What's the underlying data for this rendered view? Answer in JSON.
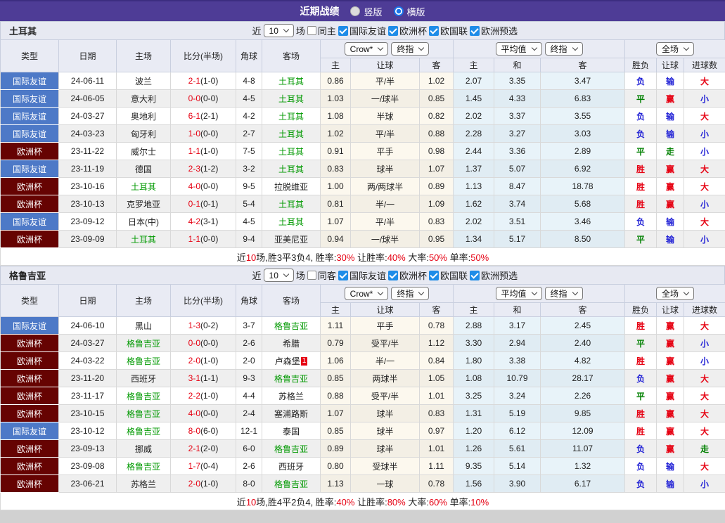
{
  "title_bar": {
    "title": "近期战绩",
    "vertical_label": "竖版",
    "horizontal_label": "横版",
    "selected": "横版"
  },
  "controls": {
    "company": "Crow*",
    "final_index": "终指",
    "average": "平均值",
    "final_index2": "终指",
    "scope": "全场"
  },
  "columns": {
    "left": [
      "类型",
      "日期",
      "主场",
      "比分(半场)",
      "角球",
      "客场"
    ],
    "crow_sub": [
      "主",
      "让球",
      "客"
    ],
    "avg_sub": [
      "主",
      "和",
      "客"
    ],
    "result_sub": [
      "胜负",
      "让球",
      "进球数"
    ]
  },
  "colors": {
    "titlebar_purple": "#4e3c96",
    "badge_friendly_blue": "#4d79c7",
    "badge_cup_maroon": "#660302",
    "win_red": "#e60012",
    "lose_blue": "#2323d6",
    "draw_green": "#008000",
    "team_green": "#009900",
    "crow_col_bg": "#fcf8ee",
    "avg_col_bg": "#e8f3f9",
    "checkbox_blue": "#1e8ce8"
  },
  "sections": [
    {
      "team": "土耳其",
      "filter": {
        "near": "近",
        "count": "10",
        "unit": "场",
        "same": "同主",
        "same_checked": false,
        "leagues": [
          "国际友谊",
          "欧洲杯",
          "欧国联",
          "欧洲预选"
        ],
        "leagues_checked": [
          true,
          true,
          true,
          true
        ]
      },
      "rows": [
        {
          "type": "国际友谊",
          "type_key": "friendly",
          "date": "24-06-11",
          "home": "波兰",
          "home_green": false,
          "score": "2-1",
          "half": "(1-0)",
          "corner": "4-8",
          "away": "土耳其",
          "away_green": true,
          "red_card": "",
          "crow": [
            "0.86",
            "平/半",
            "1.02"
          ],
          "avg": [
            "2.07",
            "3.35",
            "3.47"
          ],
          "res": [
            [
              "负",
              "b"
            ],
            [
              "输",
              "b"
            ],
            [
              "大",
              "r"
            ]
          ]
        },
        {
          "type": "国际友谊",
          "type_key": "friendly",
          "date": "24-06-05",
          "home": "意大利",
          "home_green": false,
          "score": "0-0",
          "half": "(0-0)",
          "corner": "4-5",
          "away": "土耳其",
          "away_green": true,
          "red_card": "",
          "crow": [
            "1.03",
            "一/球半",
            "0.85"
          ],
          "avg": [
            "1.45",
            "4.33",
            "6.83"
          ],
          "res": [
            [
              "平",
              "g"
            ],
            [
              "赢",
              "r"
            ],
            [
              "小",
              "b"
            ]
          ]
        },
        {
          "type": "国际友谊",
          "type_key": "friendly",
          "date": "24-03-27",
          "home": "奥地利",
          "home_green": false,
          "score": "6-1",
          "half": "(2-1)",
          "corner": "4-2",
          "away": "土耳其",
          "away_green": true,
          "red_card": "",
          "crow": [
            "1.08",
            "半球",
            "0.82"
          ],
          "avg": [
            "2.02",
            "3.37",
            "3.55"
          ],
          "res": [
            [
              "负",
              "b"
            ],
            [
              "输",
              "b"
            ],
            [
              "大",
              "r"
            ]
          ]
        },
        {
          "type": "国际友谊",
          "type_key": "friendly",
          "date": "24-03-23",
          "home": "匈牙利",
          "home_green": false,
          "score": "1-0",
          "half": "(0-0)",
          "corner": "2-7",
          "away": "土耳其",
          "away_green": true,
          "red_card": "",
          "crow": [
            "1.02",
            "平/半",
            "0.88"
          ],
          "avg": [
            "2.28",
            "3.27",
            "3.03"
          ],
          "res": [
            [
              "负",
              "b"
            ],
            [
              "输",
              "b"
            ],
            [
              "小",
              "b"
            ]
          ]
        },
        {
          "type": "欧洲杯",
          "type_key": "cup",
          "date": "23-11-22",
          "home": "威尔士",
          "home_green": false,
          "score": "1-1",
          "half": "(1-0)",
          "corner": "7-5",
          "away": "土耳其",
          "away_green": true,
          "red_card": "",
          "crow": [
            "0.91",
            "平手",
            "0.98"
          ],
          "avg": [
            "2.44",
            "3.36",
            "2.89"
          ],
          "res": [
            [
              "平",
              "g"
            ],
            [
              "走",
              "g"
            ],
            [
              "小",
              "b"
            ]
          ]
        },
        {
          "type": "国际友谊",
          "type_key": "friendly",
          "date": "23-11-19",
          "home": "德国",
          "home_green": false,
          "score": "2-3",
          "half": "(1-2)",
          "corner": "3-2",
          "away": "土耳其",
          "away_green": true,
          "red_card": "",
          "crow": [
            "0.83",
            "球半",
            "1.07"
          ],
          "avg": [
            "1.37",
            "5.07",
            "6.92"
          ],
          "res": [
            [
              "胜",
              "r"
            ],
            [
              "赢",
              "r"
            ],
            [
              "大",
              "r"
            ]
          ]
        },
        {
          "type": "欧洲杯",
          "type_key": "cup",
          "date": "23-10-16",
          "home": "土耳其",
          "home_green": true,
          "score": "4-0",
          "half": "(0-0)",
          "corner": "9-5",
          "away": "拉脱维亚",
          "away_green": false,
          "red_card": "",
          "crow": [
            "1.00",
            "两/两球半",
            "0.89"
          ],
          "avg": [
            "1.13",
            "8.47",
            "18.78"
          ],
          "res": [
            [
              "胜",
              "r"
            ],
            [
              "赢",
              "r"
            ],
            [
              "大",
              "r"
            ]
          ]
        },
        {
          "type": "欧洲杯",
          "type_key": "cup",
          "date": "23-10-13",
          "home": "克罗地亚",
          "home_green": false,
          "score": "0-1",
          "half": "(0-1)",
          "corner": "5-4",
          "away": "土耳其",
          "away_green": true,
          "red_card": "",
          "crow": [
            "0.81",
            "半/一",
            "1.09"
          ],
          "avg": [
            "1.62",
            "3.74",
            "5.68"
          ],
          "res": [
            [
              "胜",
              "r"
            ],
            [
              "赢",
              "r"
            ],
            [
              "小",
              "b"
            ]
          ]
        },
        {
          "type": "国际友谊",
          "type_key": "friendly",
          "date": "23-09-12",
          "home": "日本(中)",
          "home_green": false,
          "score": "4-2",
          "half": "(3-1)",
          "corner": "4-5",
          "away": "土耳其",
          "away_green": true,
          "red_card": "",
          "crow": [
            "1.07",
            "平/半",
            "0.83"
          ],
          "avg": [
            "2.02",
            "3.51",
            "3.46"
          ],
          "res": [
            [
              "负",
              "b"
            ],
            [
              "输",
              "b"
            ],
            [
              "大",
              "r"
            ]
          ]
        },
        {
          "type": "欧洲杯",
          "type_key": "cup",
          "date": "23-09-09",
          "home": "土耳其",
          "home_green": true,
          "score": "1-1",
          "half": "(0-0)",
          "corner": "9-4",
          "away": "亚美尼亚",
          "away_green": false,
          "red_card": "",
          "crow": [
            "0.94",
            "一/球半",
            "0.95"
          ],
          "avg": [
            "1.34",
            "5.17",
            "8.50"
          ],
          "res": [
            [
              "平",
              "g"
            ],
            [
              "输",
              "b"
            ],
            [
              "小",
              "b"
            ]
          ]
        }
      ],
      "summary": [
        {
          "t": "近",
          "red": false
        },
        {
          "t": "10",
          "red": true
        },
        {
          "t": "场,胜3平3负4, 胜率:",
          "red": false
        },
        {
          "t": "30%",
          "red": true
        },
        {
          "t": " 让胜率:",
          "red": false
        },
        {
          "t": "40%",
          "red": true
        },
        {
          "t": " 大率:",
          "red": false
        },
        {
          "t": "50%",
          "red": true
        },
        {
          "t": " 单率:",
          "red": false
        },
        {
          "t": "50%",
          "red": true
        }
      ]
    },
    {
      "team": "格鲁吉亚",
      "filter": {
        "near": "近",
        "count": "10",
        "unit": "场",
        "same": "同客",
        "same_checked": false,
        "leagues": [
          "国际友谊",
          "欧洲杯",
          "欧国联",
          "欧洲预选"
        ],
        "leagues_checked": [
          true,
          true,
          true,
          true
        ]
      },
      "rows": [
        {
          "type": "国际友谊",
          "type_key": "friendly",
          "date": "24-06-10",
          "home": "黑山",
          "home_green": false,
          "score": "1-3",
          "half": "(0-2)",
          "corner": "3-7",
          "away": "格鲁吉亚",
          "away_green": true,
          "red_card": "",
          "crow": [
            "1.11",
            "平手",
            "0.78"
          ],
          "avg": [
            "2.88",
            "3.17",
            "2.45"
          ],
          "res": [
            [
              "胜",
              "r"
            ],
            [
              "赢",
              "r"
            ],
            [
              "大",
              "r"
            ]
          ]
        },
        {
          "type": "欧洲杯",
          "type_key": "cup",
          "date": "24-03-27",
          "home": "格鲁吉亚",
          "home_green": true,
          "score": "0-0",
          "half": "(0-0)",
          "corner": "2-6",
          "away": "希腊",
          "away_green": false,
          "red_card": "",
          "crow": [
            "0.79",
            "受平/半",
            "1.12"
          ],
          "avg": [
            "3.30",
            "2.94",
            "2.40"
          ],
          "res": [
            [
              "平",
              "g"
            ],
            [
              "赢",
              "r"
            ],
            [
              "小",
              "b"
            ]
          ]
        },
        {
          "type": "欧洲杯",
          "type_key": "cup",
          "date": "24-03-22",
          "home": "格鲁吉亚",
          "home_green": true,
          "score": "2-0",
          "half": "(1-0)",
          "corner": "2-0",
          "away": "卢森堡",
          "away_green": false,
          "red_card": "1",
          "crow": [
            "1.06",
            "半/一",
            "0.84"
          ],
          "avg": [
            "1.80",
            "3.38",
            "4.82"
          ],
          "res": [
            [
              "胜",
              "r"
            ],
            [
              "赢",
              "r"
            ],
            [
              "小",
              "b"
            ]
          ]
        },
        {
          "type": "欧洲杯",
          "type_key": "cup",
          "date": "23-11-20",
          "home": "西班牙",
          "home_green": false,
          "score": "3-1",
          "half": "(1-1)",
          "corner": "9-3",
          "away": "格鲁吉亚",
          "away_green": true,
          "red_card": "",
          "crow": [
            "0.85",
            "两球半",
            "1.05"
          ],
          "avg": [
            "1.08",
            "10.79",
            "28.17"
          ],
          "res": [
            [
              "负",
              "b"
            ],
            [
              "赢",
              "r"
            ],
            [
              "大",
              "r"
            ]
          ]
        },
        {
          "type": "欧洲杯",
          "type_key": "cup",
          "date": "23-11-17",
          "home": "格鲁吉亚",
          "home_green": true,
          "score": "2-2",
          "half": "(1-0)",
          "corner": "4-4",
          "away": "苏格兰",
          "away_green": false,
          "red_card": "",
          "crow": [
            "0.88",
            "受平/半",
            "1.01"
          ],
          "avg": [
            "3.25",
            "3.24",
            "2.26"
          ],
          "res": [
            [
              "平",
              "g"
            ],
            [
              "赢",
              "r"
            ],
            [
              "大",
              "r"
            ]
          ]
        },
        {
          "type": "欧洲杯",
          "type_key": "cup",
          "date": "23-10-15",
          "home": "格鲁吉亚",
          "home_green": true,
          "score": "4-0",
          "half": "(0-0)",
          "corner": "2-4",
          "away": "塞浦路斯",
          "away_green": false,
          "red_card": "",
          "crow": [
            "1.07",
            "球半",
            "0.83"
          ],
          "avg": [
            "1.31",
            "5.19",
            "9.85"
          ],
          "res": [
            [
              "胜",
              "r"
            ],
            [
              "赢",
              "r"
            ],
            [
              "大",
              "r"
            ]
          ]
        },
        {
          "type": "国际友谊",
          "type_key": "friendly",
          "date": "23-10-12",
          "home": "格鲁吉亚",
          "home_green": true,
          "score": "8-0",
          "half": "(6-0)",
          "corner": "12-1",
          "away": "泰国",
          "away_green": false,
          "red_card": "",
          "crow": [
            "0.85",
            "球半",
            "0.97"
          ],
          "avg": [
            "1.20",
            "6.12",
            "12.09"
          ],
          "res": [
            [
              "胜",
              "r"
            ],
            [
              "赢",
              "r"
            ],
            [
              "大",
              "r"
            ]
          ]
        },
        {
          "type": "欧洲杯",
          "type_key": "cup",
          "date": "23-09-13",
          "home": "挪威",
          "home_green": false,
          "score": "2-1",
          "half": "(2-0)",
          "corner": "6-0",
          "away": "格鲁吉亚",
          "away_green": true,
          "red_card": "",
          "crow": [
            "0.89",
            "球半",
            "1.01"
          ],
          "avg": [
            "1.26",
            "5.61",
            "11.07"
          ],
          "res": [
            [
              "负",
              "b"
            ],
            [
              "赢",
              "r"
            ],
            [
              "走",
              "g"
            ]
          ]
        },
        {
          "type": "欧洲杯",
          "type_key": "cup",
          "date": "23-09-08",
          "home": "格鲁吉亚",
          "home_green": true,
          "score": "1-7",
          "half": "(0-4)",
          "corner": "2-6",
          "away": "西班牙",
          "away_green": false,
          "red_card": "",
          "crow": [
            "0.80",
            "受球半",
            "1.11"
          ],
          "avg": [
            "9.35",
            "5.14",
            "1.32"
          ],
          "res": [
            [
              "负",
              "b"
            ],
            [
              "输",
              "b"
            ],
            [
              "大",
              "r"
            ]
          ]
        },
        {
          "type": "欧洲杯",
          "type_key": "cup",
          "date": "23-06-21",
          "home": "苏格兰",
          "home_green": false,
          "score": "2-0",
          "half": "(1-0)",
          "corner": "8-0",
          "away": "格鲁吉亚",
          "away_green": true,
          "red_card": "",
          "crow": [
            "1.13",
            "一球",
            "0.78"
          ],
          "avg": [
            "1.56",
            "3.90",
            "6.17"
          ],
          "res": [
            [
              "负",
              "b"
            ],
            [
              "输",
              "b"
            ],
            [
              "小",
              "b"
            ]
          ]
        }
      ],
      "summary": [
        {
          "t": "近",
          "red": false
        },
        {
          "t": "10",
          "red": true
        },
        {
          "t": "场,胜4平2负4, 胜率:",
          "red": false
        },
        {
          "t": "40%",
          "red": true
        },
        {
          "t": " 让胜率:",
          "red": false
        },
        {
          "t": "80%",
          "red": true
        },
        {
          "t": " 大率:",
          "red": false
        },
        {
          "t": "60%",
          "red": true
        },
        {
          "t": " 单率:",
          "red": false
        },
        {
          "t": "10%",
          "red": true
        }
      ]
    }
  ]
}
